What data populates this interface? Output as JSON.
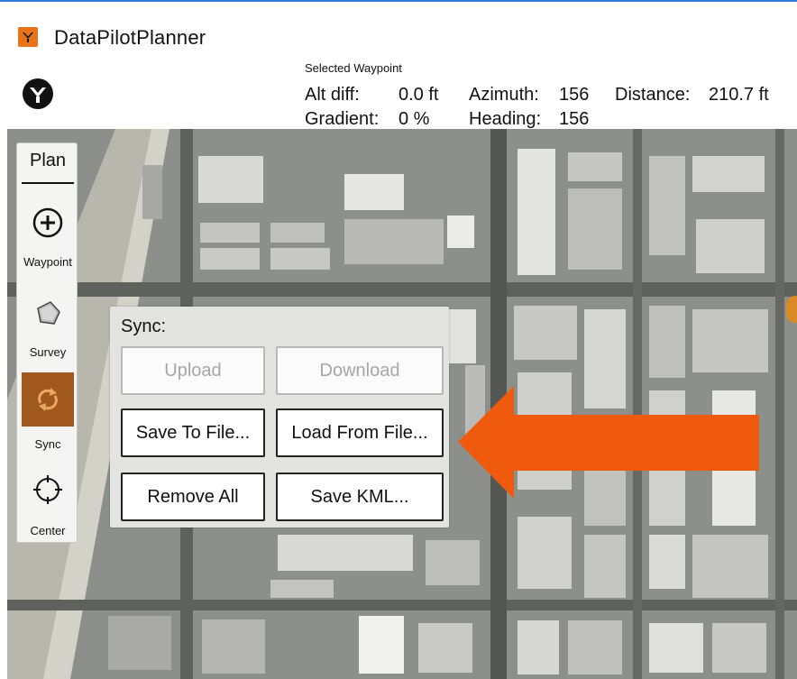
{
  "window": {
    "title": "DataPilotPlanner",
    "accent_color": "#2f7fd6",
    "app_icon": "app-logo-icon",
    "app_icon_color": "#e8731a"
  },
  "header": {
    "logo_icon": "brand-logo-icon",
    "selected_waypoint_label": "Selected Waypoint",
    "alt_diff_label": "Alt diff:",
    "alt_diff_value": "0.0 ft",
    "azimuth_label": "Azimuth:",
    "azimuth_value": "156",
    "distance_label": "Distance:",
    "distance_value": "210.7 ft",
    "gradient_label": "Gradient:",
    "gradient_value": "0 %",
    "heading_label": "Heading:",
    "heading_value": "156"
  },
  "plan_panel": {
    "title": "Plan",
    "tools": [
      {
        "label": "Waypoint",
        "icon": "plus-circle-icon",
        "active": false
      },
      {
        "label": "Survey",
        "icon": "polygon-icon",
        "active": false
      },
      {
        "label": "Sync",
        "icon": "sync-icon",
        "active": true
      },
      {
        "label": "Center",
        "icon": "crosshair-icon",
        "active": false
      }
    ],
    "active_color": "#a0581c"
  },
  "sync_panel": {
    "title": "Sync:",
    "upload_label": "Upload",
    "download_label": "Download",
    "save_to_file_label": "Save To File...",
    "load_from_file_label": "Load From File...",
    "remove_all_label": "Remove All",
    "save_kml_label": "Save KML..."
  },
  "annotation": {
    "arrow_color": "#f05a0f",
    "points_to": "Load From File..."
  }
}
